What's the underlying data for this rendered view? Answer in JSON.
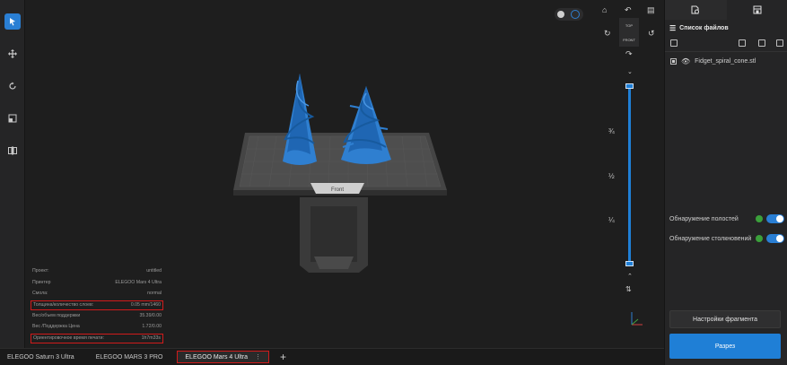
{
  "colors": {
    "accent": "#1f7fd6",
    "highlight": "#d01b1b",
    "model": "#2f7fd0",
    "platform": "#3b3b3b",
    "toggle_ok": "#3ba03b"
  },
  "left_toolbar": [
    {
      "name": "select-tool-icon",
      "icon": "cursor"
    },
    {
      "name": "move-tool-icon",
      "icon": "move"
    },
    {
      "name": "rotate-tool-icon",
      "icon": "rotate"
    },
    {
      "name": "scale-tool-icon",
      "icon": "scale"
    },
    {
      "name": "mirror-tool-icon",
      "icon": "mirror"
    }
  ],
  "viewport": {
    "platform_label": "Front",
    "cube_top_label": "TOP",
    "cube_front_label": "FRONT",
    "slider_marks": [
      "¾",
      "½",
      "¼"
    ]
  },
  "info": {
    "rows": [
      {
        "label": "Проект:",
        "value": "untitled",
        "highlight": false
      },
      {
        "label": "Принтер",
        "value": "ELEGOO Mars 4 Ultra",
        "highlight": false
      },
      {
        "label": "Смола:",
        "value": "normal",
        "highlight": false
      },
      {
        "label": "Толщина/количество слоев:",
        "value": "0.05 mm/1460",
        "highlight": true
      },
      {
        "label": "Вес/объем поддержки",
        "value": "35.39/0.00",
        "highlight": false
      },
      {
        "label": "Вес /Поддержка Цена",
        "value": "1.72/0.00",
        "highlight": false
      },
      {
        "label": "Ориентировочное время печати:",
        "value": "1h7m33s",
        "highlight": true
      }
    ]
  },
  "right_panel": {
    "tabs": [
      {
        "icon": "file-settings-icon"
      },
      {
        "icon": "printer-icon"
      }
    ],
    "file_list_title": "Список файлов",
    "files": [
      {
        "name": "Fidget_spiral_cone.stl"
      }
    ],
    "toggles": [
      {
        "label": "Обнаружение полостей",
        "enabled": true
      },
      {
        "label": "Обнаружение столкновений",
        "enabled": true
      }
    ],
    "fragment_settings_label": "Настройки фрагмента",
    "slice_label": "Разрез"
  },
  "bottom_tabs": [
    {
      "label": "ELEGOO Saturn 3 Ultra",
      "active": false
    },
    {
      "label": "ELEGOO MARS 3 PRO",
      "active": false
    },
    {
      "label": "ELEGOO Mars 4 Ultra",
      "active": true
    }
  ],
  "add_tab_label": "+"
}
